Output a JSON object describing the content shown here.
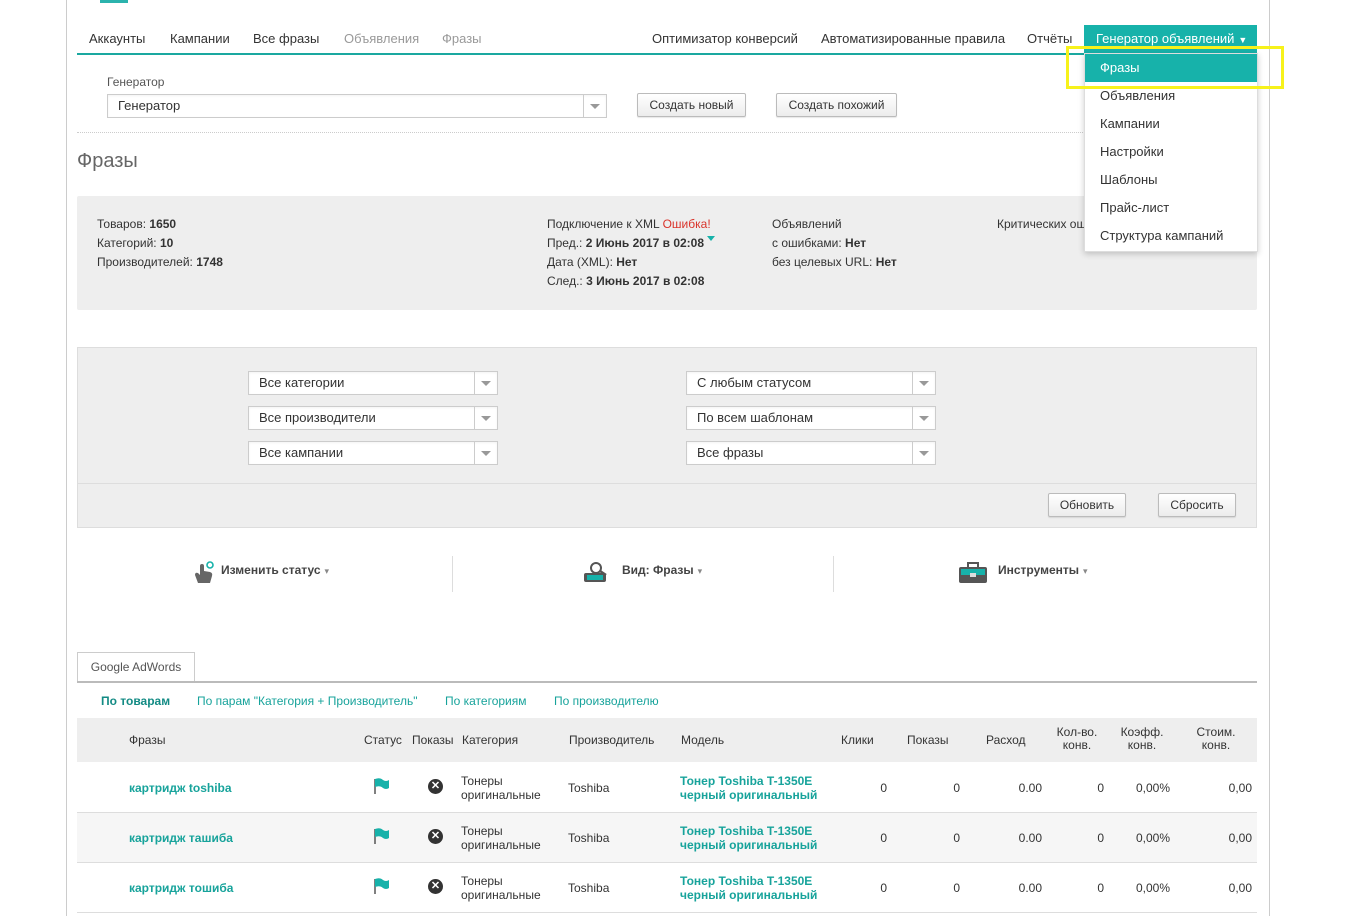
{
  "nav": {
    "items": [
      "Аккаунты",
      "Кампании",
      "Все фразы",
      "Объявления",
      "Фразы"
    ],
    "right_items": [
      "Оптимизатор конверсий",
      "Автоматизированные правила",
      "Отчёты"
    ],
    "active": "Генератор объявлений",
    "caret": "▼"
  },
  "dropdown": {
    "items": [
      "Фразы",
      "Объявления",
      "Кампании",
      "Настройки",
      "Шаблоны",
      "Прайс-лист",
      "Структура кампаний"
    ]
  },
  "generator": {
    "label": "Генератор",
    "selected": "Генератор",
    "create_new": "Создать новый",
    "create_similar": "Создать похожий"
  },
  "page_title": "Фразы",
  "stats": {
    "products_label": "Товаров:",
    "products": "1650",
    "categories_label": "Категорий:",
    "categories": "10",
    "manufacturers_label": "Производителей:",
    "manufacturers": "1748",
    "xml_label": "Подключение к XML",
    "xml_status": "Ошибка!",
    "prev_label": "Пред.:",
    "prev": "2 Июнь 2017 в 02:08",
    "xml_date_label": "Дата (XML):",
    "xml_date": "Нет",
    "next_label": "След.:",
    "next": "3 Июнь 2017 в 02:08",
    "ads_label": "Объявлений",
    "with_errors_label": "с ошибками:",
    "with_errors": "Нет",
    "no_url_label": "без целевых URL:",
    "no_url": "Нет",
    "critical_label": "Критических ош"
  },
  "filters": {
    "categories": "Все категории",
    "manufacturers": "Все производители",
    "campaigns": "Все кампании",
    "status": "С любым статусом",
    "templates": "По всем шаблонам",
    "phrases": "Все фразы",
    "refresh": "Обновить",
    "reset": "Сбросить"
  },
  "actions": {
    "change_status": "Изменить статус",
    "view": "Вид: Фразы",
    "tools": "Инструменты",
    "caret": "▾"
  },
  "tab": "Google AdWords",
  "subtabs": [
    "По товарам",
    "По парам \"Категория + Производитель\"",
    "По категориям",
    "По производителю"
  ],
  "table": {
    "headers": {
      "phrases": "Фразы",
      "status": "Статус",
      "impr_toggle": "Показы",
      "category": "Категория",
      "manufacturer": "Производитель",
      "model": "Модель",
      "clicks": "Клики",
      "impressions": "Показы",
      "cost": "Расход",
      "conv_l1": "Кол-во.",
      "conv_l2": "конв.",
      "rate_l1": "Коэфф.",
      "rate_l2": "конв.",
      "cpc_l1": "Стоим.",
      "cpc_l2": "конв."
    },
    "rows": [
      {
        "phrase": "картридж toshiba",
        "cat1": "Тонеры",
        "cat2": "оригинальные",
        "maker": "Toshiba",
        "model1": "Тонер Toshiba T-1350E",
        "model2": "черный оригинальный",
        "clicks": "0",
        "impressions": "0",
        "cost": "0.00",
        "conv": "0",
        "rate": "0,00%",
        "cpc": "0,00"
      },
      {
        "phrase": "картридж ташиба",
        "cat1": "Тонеры",
        "cat2": "оригинальные",
        "maker": "Toshiba",
        "model1": "Тонер Toshiba T-1350E",
        "model2": "черный оригинальный",
        "clicks": "0",
        "impressions": "0",
        "cost": "0.00",
        "conv": "0",
        "rate": "0,00%",
        "cpc": "0,00"
      },
      {
        "phrase": "картридж тошиба",
        "cat1": "Тонеры",
        "cat2": "оригинальные",
        "maker": "Toshiba",
        "model1": "Тонер Toshiba T-1350E",
        "model2": "черный оригинальный",
        "clicks": "0",
        "impressions": "0",
        "cost": "0.00",
        "conv": "0",
        "rate": "0,00%",
        "cpc": "0,00"
      }
    ]
  },
  "colors": {
    "accent": "#17b2aa",
    "link": "#17a39b",
    "error": "#d9342b",
    "highlight": "#f7f21b"
  }
}
